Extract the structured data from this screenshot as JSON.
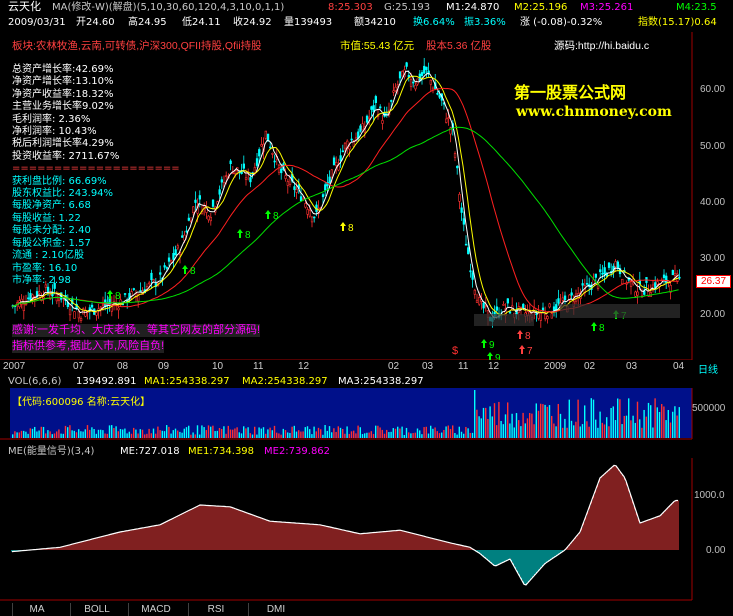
{
  "header": {
    "stock_name": "云天化",
    "indicator": "MA(修改-W)(解盘)(5,10,30,60,120,4,3,10,0,1,1)",
    "ma_values": [
      {
        "label": "8:25.303",
        "color": "#ff4040"
      },
      {
        "label": "G:25.193",
        "color": "#c0c0c0"
      },
      {
        "label": "M1:24.870",
        "color": "#ffffff"
      },
      {
        "label": "M2:25.196",
        "color": "#ffff00"
      },
      {
        "label": "M3:25.261",
        "color": "#ff00ff"
      },
      {
        "label": "M4:23.5",
        "color": "#00ff00"
      }
    ],
    "date": "2009/03/31",
    "open": "开24.60",
    "high": "高24.95",
    "low": "低24.11",
    "close": "收24.92",
    "volume": "量139493",
    "amount": "额34210",
    "turnover": "换6.64%",
    "amplitude": "振3.36%",
    "change": "涨 (-0.08)-0.32%",
    "index": "指数(15.17)0.64"
  },
  "info_line": {
    "sector": "板块:农林牧渔,云南,可转债,沪深300,QFII持股,Qfii持股",
    "pe": "市值:55.43 亿元",
    "capital": "股本5.36 亿股",
    "source": "源码:http://hi.baidu.c"
  },
  "watermark": {
    "title": "第一股票公式网",
    "url": "www.chnmoney.com"
  },
  "fundamentals": [
    {
      "label": "总资产增长率:42.69%",
      "color": "#ffffff"
    },
    {
      "label": "净资产增长率:13.10%",
      "color": "#ffffff"
    },
    {
      "label": "净资产收益率:18.32%",
      "color": "#ffffff"
    },
    {
      "label": "主营业务增长率9.02%",
      "color": "#ffffff"
    },
    {
      "label": "毛利润率:    2.36%",
      "color": "#ffffff"
    },
    {
      "label": "净利润率:    10.43%",
      "color": "#ffffff"
    },
    {
      "label": "税后利润增长率4.29%",
      "color": "#ffffff"
    },
    {
      "label": "投资收益率:   2711.67%",
      "color": "#ffffff"
    },
    {
      "label": "====================",
      "color": "#ff4040"
    },
    {
      "label": "获利盘比例:   66.69%",
      "color": "#00ffff"
    },
    {
      "label": "股东权益比:   243.94%",
      "color": "#00ffff"
    },
    {
      "label": "每股净资产:   6.68",
      "color": "#00ffff"
    },
    {
      "label": "每股收益:     1.22",
      "color": "#00ffff"
    },
    {
      "label": "每股未分配:   2.40",
      "color": "#00ffff"
    },
    {
      "label": "每股公积金:   1.57",
      "color": "#00ffff"
    },
    {
      "label": "流通   :     2.10亿股",
      "color": "#00ffff"
    },
    {
      "label": "市盈率:      16.10",
      "color": "#00ffff"
    },
    {
      "label": "市净率:      2.98",
      "color": "#00ffff"
    }
  ],
  "notes": {
    "line1": "感谢:一发千均、大庆老杨、等其它网友的部分源码!",
    "line2": "指标供参考,据此入市,风险自负!"
  },
  "price_axis": [
    "60.00",
    "50.00",
    "40.00",
    "30.00",
    "20.00"
  ],
  "current_price": "26.37",
  "signal_labels": [
    "8",
    "8",
    "8",
    "8",
    "8",
    "9",
    "9",
    "8",
    "7",
    "8",
    "7"
  ],
  "dates": [
    "2007",
    "07",
    "08",
    "09",
    "10",
    "11",
    "12",
    "02",
    "03",
    "11",
    "12",
    "2009",
    "02",
    "03",
    "04"
  ],
  "date_end_label": "日线",
  "volume": {
    "title": "VOL(6,6,6)",
    "vol": "139492.891",
    "ma1": "MA1:254338.297",
    "ma2": "MA2:254338.297",
    "ma3": "MA3:254338.297",
    "code_label": "【代码:600096 名称:云天化】",
    "axis": "500000"
  },
  "me": {
    "title": "ME(能量信号)(3,4)",
    "me": "ME:727.018",
    "me1": "ME1:734.398",
    "me2": "ME2:739.862",
    "axis": [
      "1000.0",
      "0.00"
    ]
  },
  "tabs": [
    "MA",
    "BOLL",
    "MACD",
    "RSI",
    "DMI"
  ]
}
